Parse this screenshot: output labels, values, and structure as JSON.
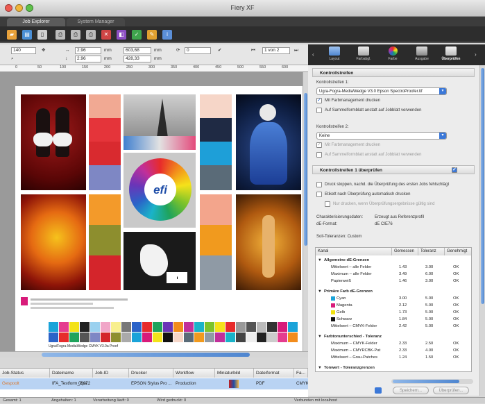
{
  "window": {
    "title": "Fiery XF"
  },
  "app_tabs": [
    {
      "label": "Job Explorer"
    },
    {
      "label": "System Manager"
    }
  ],
  "editbar": {
    "copies": "140",
    "width_value": "2.96",
    "width_unit": "mm",
    "height_value": "2.96",
    "height_unit": "mm",
    "size_w": "603,68",
    "size_w_unit": "mm",
    "size_h": "428,33",
    "size_h_unit": "mm",
    "rotation": "0",
    "page_indicator": "1 von 2"
  },
  "ruler": {
    "ticks": [
      "0",
      "50",
      "100",
      "150",
      "200",
      "250",
      "300",
      "350",
      "400",
      "450",
      "500",
      "550",
      "600"
    ]
  },
  "sheet": {
    "logo_text": "efi",
    "strip_label": "Ugra/Fogra-MediaWedge CMYK V3.0a Proof"
  },
  "job_table": {
    "columns": [
      "Job-Status",
      "Dateiname",
      "Job-ID",
      "Drucker",
      "Workflow",
      "Miniaturbild",
      "Dateiformat",
      "Fa..."
    ],
    "row": {
      "status": "Gespoolt",
      "filename": "IFA_Testform_2pa...",
      "job_id": "00072",
      "printer": "EPSON Stylus Pro ...",
      "workflow": "Production",
      "format": "PDF",
      "color": "CMYK"
    }
  },
  "status_bar": {
    "total": "Gesamt: 1",
    "held": "Angehalten: 1",
    "processing": "Verarbeitung läuft: 0",
    "printing": "Wird gedruckt: 0",
    "connection": "Verbunden mit localhost"
  },
  "panel_tabs": [
    {
      "label": "Layout",
      "icon": "layout-icon"
    },
    {
      "label": "Farbabgl.",
      "icon": "color-balance-icon"
    },
    {
      "label": "Farbe",
      "icon": "color-wheel-icon"
    },
    {
      "label": "Ausgabe",
      "icon": "printer-icon"
    },
    {
      "label": "Überprüfen",
      "icon": "verify-icon"
    }
  ],
  "panel": {
    "section1_title": "Kontrollstreifen",
    "strip1_label": "Kontrollstreifen 1:",
    "strip1_value": "Ugra-Fogra-MediaWedge V3.0 Epson SpectroProofer.tif",
    "strip1_cm": "Mit Farbmanagement drucken",
    "strip1_sheet": "Auf Sammelformblatt anstatt auf Jobblatt verwenden",
    "strip2_label": "Kontrollstreifen 2:",
    "strip2_value": "Keine",
    "strip2_cm": "Mit Farbmanagement drucken",
    "strip2_sheet": "Auf Sammelformblatt anstatt auf Jobblatt verwenden",
    "section2_title": "Kontrollstreifen 1 überprüfen",
    "opt_stop": "Druck stoppen, nachd. die Überprüfung des ersten Jobs fehlschlägt",
    "opt_label": "Etikett nach Überprüfung automatisch drucken",
    "opt_only_valid": "Nur drucken, wenn Überprüfungsergebnisse gültig sind",
    "char_data_label": "Charakterisierungsdaten:",
    "char_data_value": "Erzeugt aus Referenzprofil",
    "de_format_label": "dE-Format:",
    "de_format_value": "dE CIE76",
    "tolerances_label": "Soll-Toleranzen: Custom",
    "buttons": {
      "save": "Speichern...",
      "check": "Überprüfen..."
    }
  },
  "tolerance_table": {
    "headers": [
      "Kanal",
      "Gemessen",
      "Toleranz",
      "Genehmigt"
    ],
    "groups": [
      {
        "title": "Allgemeine dE-Grenzen",
        "rows": [
          {
            "name": "Mittelwert – alle Felder",
            "measured": "1.43",
            "tolerance": "3.00",
            "ok": "OK"
          },
          {
            "name": "Maximum – alle Felder",
            "measured": "3.49",
            "tolerance": "6.00",
            "ok": "OK"
          },
          {
            "name": "Papierweiß",
            "measured": "1.46",
            "tolerance": "3.00",
            "ok": "OK"
          }
        ]
      },
      {
        "title": "Primäre Farb dE-Grenzen",
        "rows": [
          {
            "name": "Cyan",
            "swatch": "#1aa3d9",
            "measured": "3.00",
            "tolerance": "5.00",
            "ok": "OK"
          },
          {
            "name": "Magenta",
            "swatch": "#d81b7a",
            "measured": "2.12",
            "tolerance": "5.00",
            "ok": "OK"
          },
          {
            "name": "Gelb",
            "swatch": "#f1e20f",
            "measured": "1.73",
            "tolerance": "5.00",
            "ok": "OK"
          },
          {
            "name": "Schwarz",
            "swatch": "#111111",
            "measured": "1.84",
            "tolerance": "5.00",
            "ok": "OK"
          },
          {
            "name": "Mittelwert – CMYK-Felder",
            "measured": "2.42",
            "tolerance": "5.00",
            "ok": "OK"
          }
        ]
      },
      {
        "title": "Farbtonunterschied - Toleranz",
        "rows": [
          {
            "name": "Maximum – CMYK-Felder",
            "measured": "2.33",
            "tolerance": "2.50",
            "ok": "OK"
          },
          {
            "name": "Maximum – CMYRCBK-Pat",
            "measured": "2.33",
            "tolerance": "4.00",
            "ok": "OK"
          },
          {
            "name": "Mittelwert – Grau-Patches",
            "measured": "1.24",
            "tolerance": "1.50",
            "ok": "OK"
          }
        ]
      },
      {
        "title": "Tonwert - Toleranzgrenzen",
        "rows": []
      }
    ]
  },
  "colors": {
    "accent": "#3b78d8",
    "job_row": "#b9d3f3",
    "status_orange": "#d9772b",
    "panel_bg": "#ececec"
  }
}
